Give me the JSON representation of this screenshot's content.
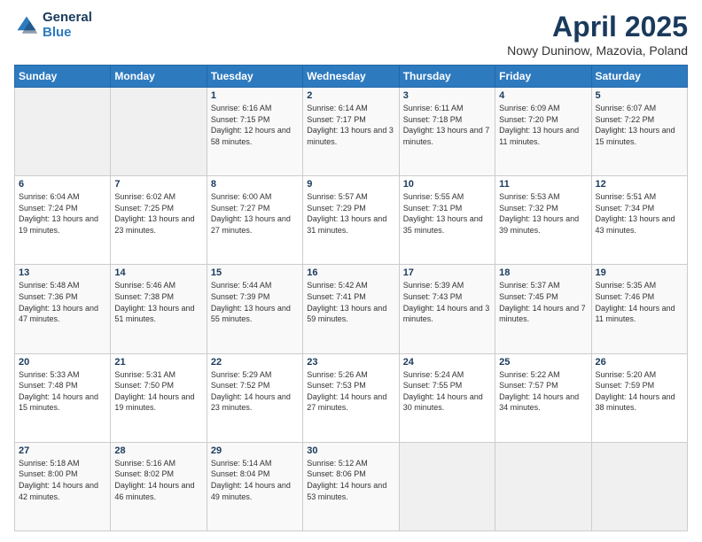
{
  "header": {
    "logo_general": "General",
    "logo_blue": "Blue",
    "title": "April 2025",
    "subtitle": "Nowy Duninow, Mazovia, Poland"
  },
  "calendar": {
    "weekdays": [
      "Sunday",
      "Monday",
      "Tuesday",
      "Wednesday",
      "Thursday",
      "Friday",
      "Saturday"
    ],
    "weeks": [
      [
        {
          "day": "",
          "sunrise": "",
          "sunset": "",
          "daylight": ""
        },
        {
          "day": "",
          "sunrise": "",
          "sunset": "",
          "daylight": ""
        },
        {
          "day": "1",
          "sunrise": "Sunrise: 6:16 AM",
          "sunset": "Sunset: 7:15 PM",
          "daylight": "Daylight: 12 hours and 58 minutes."
        },
        {
          "day": "2",
          "sunrise": "Sunrise: 6:14 AM",
          "sunset": "Sunset: 7:17 PM",
          "daylight": "Daylight: 13 hours and 3 minutes."
        },
        {
          "day": "3",
          "sunrise": "Sunrise: 6:11 AM",
          "sunset": "Sunset: 7:18 PM",
          "daylight": "Daylight: 13 hours and 7 minutes."
        },
        {
          "day": "4",
          "sunrise": "Sunrise: 6:09 AM",
          "sunset": "Sunset: 7:20 PM",
          "daylight": "Daylight: 13 hours and 11 minutes."
        },
        {
          "day": "5",
          "sunrise": "Sunrise: 6:07 AM",
          "sunset": "Sunset: 7:22 PM",
          "daylight": "Daylight: 13 hours and 15 minutes."
        }
      ],
      [
        {
          "day": "6",
          "sunrise": "Sunrise: 6:04 AM",
          "sunset": "Sunset: 7:24 PM",
          "daylight": "Daylight: 13 hours and 19 minutes."
        },
        {
          "day": "7",
          "sunrise": "Sunrise: 6:02 AM",
          "sunset": "Sunset: 7:25 PM",
          "daylight": "Daylight: 13 hours and 23 minutes."
        },
        {
          "day": "8",
          "sunrise": "Sunrise: 6:00 AM",
          "sunset": "Sunset: 7:27 PM",
          "daylight": "Daylight: 13 hours and 27 minutes."
        },
        {
          "day": "9",
          "sunrise": "Sunrise: 5:57 AM",
          "sunset": "Sunset: 7:29 PM",
          "daylight": "Daylight: 13 hours and 31 minutes."
        },
        {
          "day": "10",
          "sunrise": "Sunrise: 5:55 AM",
          "sunset": "Sunset: 7:31 PM",
          "daylight": "Daylight: 13 hours and 35 minutes."
        },
        {
          "day": "11",
          "sunrise": "Sunrise: 5:53 AM",
          "sunset": "Sunset: 7:32 PM",
          "daylight": "Daylight: 13 hours and 39 minutes."
        },
        {
          "day": "12",
          "sunrise": "Sunrise: 5:51 AM",
          "sunset": "Sunset: 7:34 PM",
          "daylight": "Daylight: 13 hours and 43 minutes."
        }
      ],
      [
        {
          "day": "13",
          "sunrise": "Sunrise: 5:48 AM",
          "sunset": "Sunset: 7:36 PM",
          "daylight": "Daylight: 13 hours and 47 minutes."
        },
        {
          "day": "14",
          "sunrise": "Sunrise: 5:46 AM",
          "sunset": "Sunset: 7:38 PM",
          "daylight": "Daylight: 13 hours and 51 minutes."
        },
        {
          "day": "15",
          "sunrise": "Sunrise: 5:44 AM",
          "sunset": "Sunset: 7:39 PM",
          "daylight": "Daylight: 13 hours and 55 minutes."
        },
        {
          "day": "16",
          "sunrise": "Sunrise: 5:42 AM",
          "sunset": "Sunset: 7:41 PM",
          "daylight": "Daylight: 13 hours and 59 minutes."
        },
        {
          "day": "17",
          "sunrise": "Sunrise: 5:39 AM",
          "sunset": "Sunset: 7:43 PM",
          "daylight": "Daylight: 14 hours and 3 minutes."
        },
        {
          "day": "18",
          "sunrise": "Sunrise: 5:37 AM",
          "sunset": "Sunset: 7:45 PM",
          "daylight": "Daylight: 14 hours and 7 minutes."
        },
        {
          "day": "19",
          "sunrise": "Sunrise: 5:35 AM",
          "sunset": "Sunset: 7:46 PM",
          "daylight": "Daylight: 14 hours and 11 minutes."
        }
      ],
      [
        {
          "day": "20",
          "sunrise": "Sunrise: 5:33 AM",
          "sunset": "Sunset: 7:48 PM",
          "daylight": "Daylight: 14 hours and 15 minutes."
        },
        {
          "day": "21",
          "sunrise": "Sunrise: 5:31 AM",
          "sunset": "Sunset: 7:50 PM",
          "daylight": "Daylight: 14 hours and 19 minutes."
        },
        {
          "day": "22",
          "sunrise": "Sunrise: 5:29 AM",
          "sunset": "Sunset: 7:52 PM",
          "daylight": "Daylight: 14 hours and 23 minutes."
        },
        {
          "day": "23",
          "sunrise": "Sunrise: 5:26 AM",
          "sunset": "Sunset: 7:53 PM",
          "daylight": "Daylight: 14 hours and 27 minutes."
        },
        {
          "day": "24",
          "sunrise": "Sunrise: 5:24 AM",
          "sunset": "Sunset: 7:55 PM",
          "daylight": "Daylight: 14 hours and 30 minutes."
        },
        {
          "day": "25",
          "sunrise": "Sunrise: 5:22 AM",
          "sunset": "Sunset: 7:57 PM",
          "daylight": "Daylight: 14 hours and 34 minutes."
        },
        {
          "day": "26",
          "sunrise": "Sunrise: 5:20 AM",
          "sunset": "Sunset: 7:59 PM",
          "daylight": "Daylight: 14 hours and 38 minutes."
        }
      ],
      [
        {
          "day": "27",
          "sunrise": "Sunrise: 5:18 AM",
          "sunset": "Sunset: 8:00 PM",
          "daylight": "Daylight: 14 hours and 42 minutes."
        },
        {
          "day": "28",
          "sunrise": "Sunrise: 5:16 AM",
          "sunset": "Sunset: 8:02 PM",
          "daylight": "Daylight: 14 hours and 46 minutes."
        },
        {
          "day": "29",
          "sunrise": "Sunrise: 5:14 AM",
          "sunset": "Sunset: 8:04 PM",
          "daylight": "Daylight: 14 hours and 49 minutes."
        },
        {
          "day": "30",
          "sunrise": "Sunrise: 5:12 AM",
          "sunset": "Sunset: 8:06 PM",
          "daylight": "Daylight: 14 hours and 53 minutes."
        },
        {
          "day": "",
          "sunrise": "",
          "sunset": "",
          "daylight": ""
        },
        {
          "day": "",
          "sunrise": "",
          "sunset": "",
          "daylight": ""
        },
        {
          "day": "",
          "sunrise": "",
          "sunset": "",
          "daylight": ""
        }
      ]
    ]
  }
}
